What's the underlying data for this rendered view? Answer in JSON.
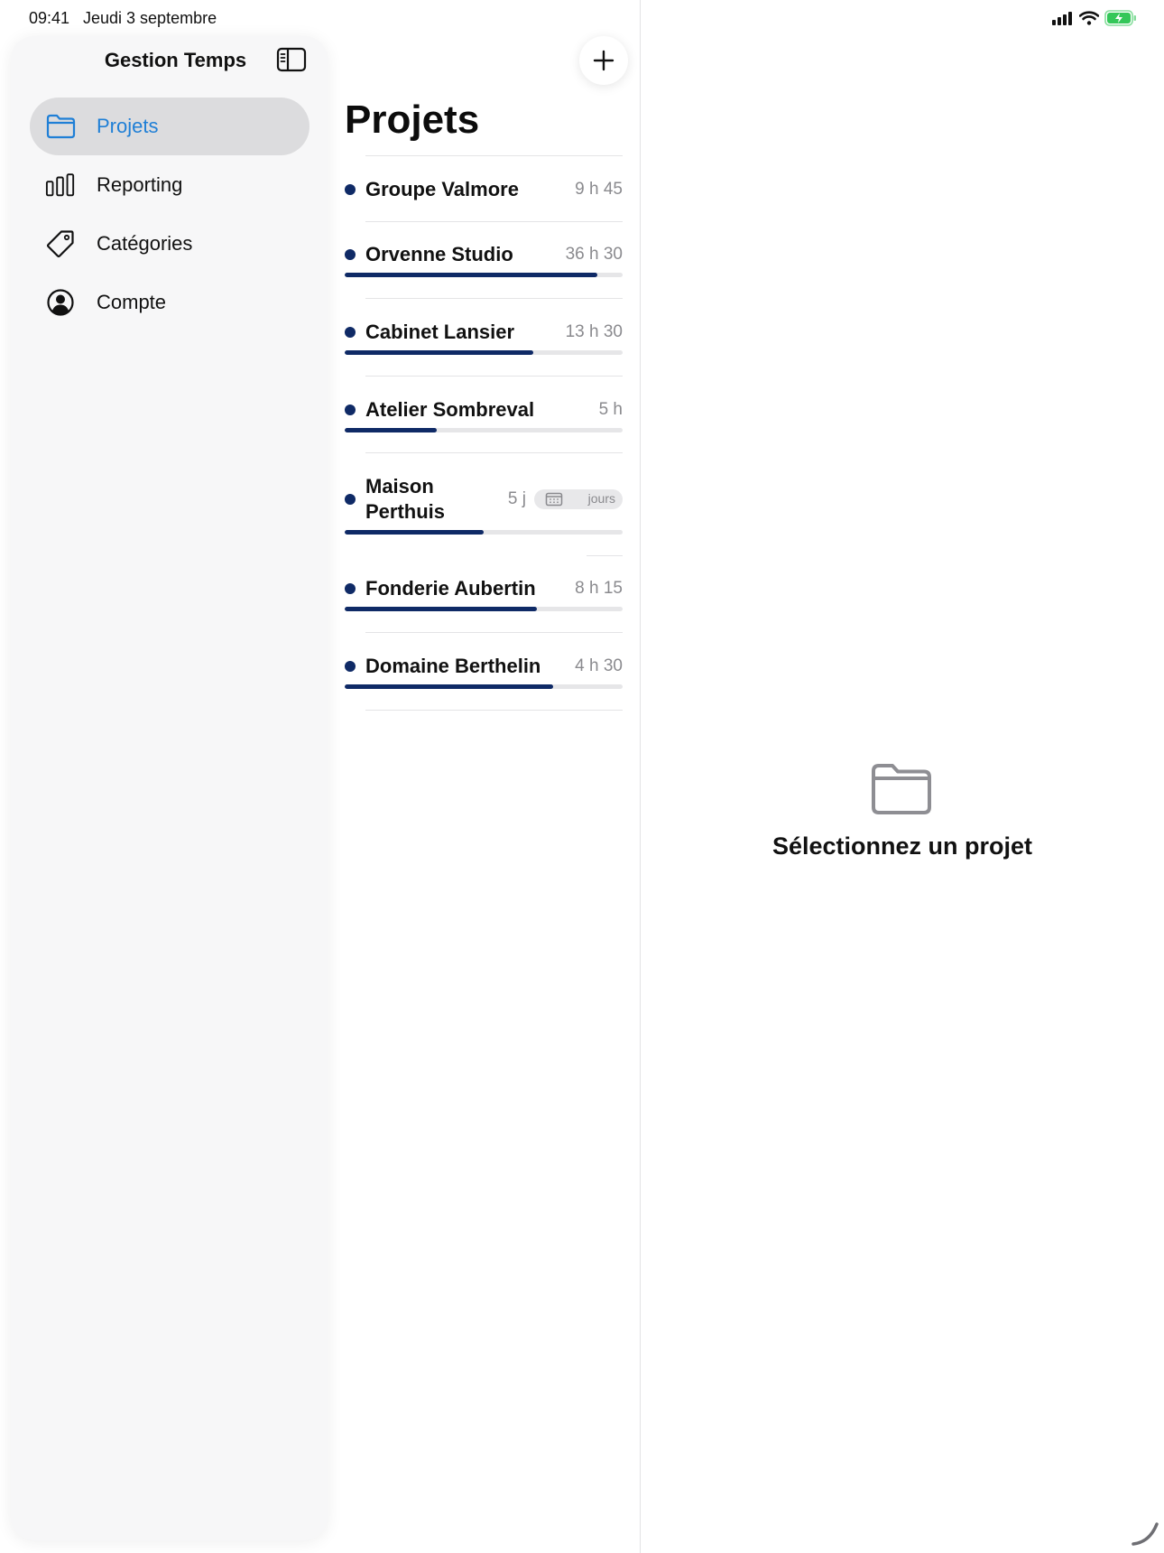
{
  "status_bar": {
    "time": "09:41",
    "date": "Jeudi 3 septembre",
    "icons": [
      "signal-icon",
      "wifi-icon",
      "battery-charging-icon"
    ],
    "battery_color": "#34c759"
  },
  "sidebar": {
    "title": "Gestion Temps",
    "toggle_icon": "sidebar-toggle-icon",
    "items": [
      {
        "label": "Projets",
        "icon": "folder-icon",
        "selected": true
      },
      {
        "label": "Reporting",
        "icon": "bar-chart-icon",
        "selected": false
      },
      {
        "label": "Catégories",
        "icon": "tag-icon",
        "selected": false
      },
      {
        "label": "Compte",
        "icon": "person-circle-icon",
        "selected": false
      }
    ]
  },
  "list": {
    "title": "Projets",
    "add_icon": "plus-icon",
    "projects": [
      {
        "name": "Groupe Valmore",
        "value": "9 h 45",
        "progress": null
      },
      {
        "name": "Orvenne Studio",
        "value": "36 h 30",
        "progress": 0.91
      },
      {
        "name": "Cabinet Lansier",
        "value": "13 h 30",
        "progress": 0.68
      },
      {
        "name": "Atelier Sombreval",
        "value": "5 h",
        "progress": 0.33
      },
      {
        "name": "Maison Perthuis",
        "value": "5 j",
        "unit_badge": "jours",
        "progress": 0.5
      },
      {
        "name": "Fonderie Aubertin",
        "value": "8 h 15",
        "progress": 0.69
      },
      {
        "name": "Domaine Berthelin",
        "value": "4 h 30",
        "progress": 0.75
      }
    ],
    "accent_color": "#0f2a66"
  },
  "detail": {
    "empty_icon": "folder-icon",
    "empty_title": "Sélectionnez un projet"
  },
  "colors": {
    "selection_blue": "#1f7fd6",
    "selected_row_bg": "#dcdcde"
  }
}
